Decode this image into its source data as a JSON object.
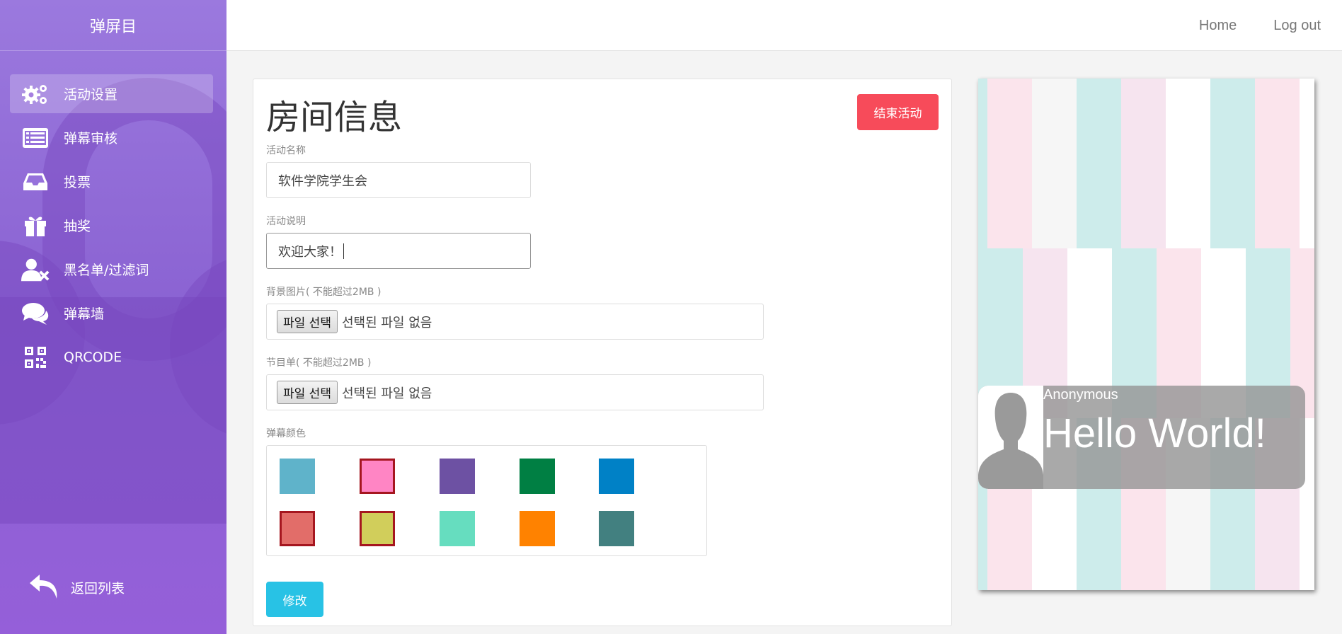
{
  "sidebar": {
    "brand": "弹屏目",
    "items": [
      {
        "label": "活动设置",
        "icon": "gears-icon",
        "active": true
      },
      {
        "label": "弹幕审核",
        "icon": "list-icon",
        "active": false
      },
      {
        "label": "投票",
        "icon": "inbox-icon",
        "active": false
      },
      {
        "label": "抽奖",
        "icon": "gift-icon",
        "active": false
      },
      {
        "label": "黑名单/过滤词",
        "icon": "user-block-icon",
        "active": false
      },
      {
        "label": "弹幕墙",
        "icon": "comments-icon",
        "active": false
      },
      {
        "label": "QRCODE",
        "icon": "qrcode-icon",
        "active": false
      }
    ],
    "back_label": "返回列表"
  },
  "topbar": {
    "home": "Home",
    "logout": "Log out"
  },
  "form": {
    "title": "房间信息",
    "end_button": "结束活动",
    "name_label": "活动名称",
    "name_value": "软件学院学生会",
    "desc_label": "活动说明",
    "desc_value": "欢迎大家！",
    "bg_label": "背景图片( 不能超过2MB )",
    "program_label": "节目单( 不能超过2MB )",
    "file_button": "파일 선택",
    "file_status": "선택된 파일 없음",
    "color_label": "弹幕颜色",
    "colors": [
      {
        "hex": "#5fb3ca",
        "selected": false
      },
      {
        "hex": "#ff85c4",
        "selected": true
      },
      {
        "hex": "#6d51a3",
        "selected": false
      },
      {
        "hex": "#007f43",
        "selected": false
      },
      {
        "hex": "#0081c6",
        "selected": false
      },
      {
        "hex": "#e26d69",
        "selected": true
      },
      {
        "hex": "#d1ce5b",
        "selected": true
      },
      {
        "hex": "#66ddbf",
        "selected": false
      },
      {
        "hex": "#ff8200",
        "selected": false
      },
      {
        "hex": "#428080",
        "selected": false
      }
    ],
    "save_button": "修改"
  },
  "preview": {
    "sender": "Anonymous",
    "message": "Hello World!"
  }
}
